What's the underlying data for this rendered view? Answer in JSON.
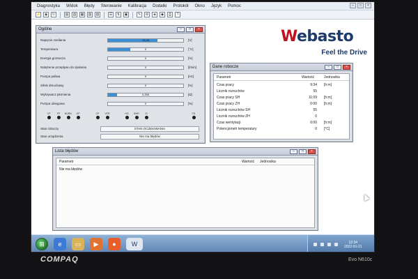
{
  "menubar": {
    "items": [
      "Diagnostyka",
      "Widok",
      "Błędy",
      "Sterowanie",
      "Kalibracja",
      "Dodatki",
      "Protokół",
      "Okno",
      "Język",
      "Pomoc"
    ]
  },
  "desktop": {
    "brand": {
      "prefix": "W",
      "rest": "ebasto",
      "slogan": "Feel the Drive"
    }
  },
  "ogolne": {
    "title": "Ogólne",
    "params": [
      {
        "label": "Napięcie zasilania",
        "value": "13,49",
        "unit": "[V]",
        "fill": 0.66
      },
      {
        "label": "Temperatura",
        "value": "0",
        "unit": "[°C]",
        "fill": 0.3
      },
      {
        "label": "Energia grzewcza",
        "value": "0",
        "unit": "[%]",
        "fill": 0
      },
      {
        "label": "Natężenie przepływu do spalania",
        "value": "0",
        "unit": "[l/min]",
        "fill": 0
      },
      {
        "label": "Pompa paliwa",
        "value": "0",
        "unit": "[Hz]",
        "fill": 0
      },
      {
        "label": "Silnik dmuchawy",
        "value": "0",
        "unit": "[%]",
        "fill": 0
      },
      {
        "label": "Wykrywacz płomienia",
        "value": "0,266",
        "unit": "[Ω]",
        "fill": 0.12
      },
      {
        "label": "Pompa obiegowa",
        "value": "0",
        "unit": "[%]",
        "fill": 0
      }
    ],
    "indicators": [
      {
        "label": "CP"
      },
      {
        "label": "FP"
      },
      {
        "label": "BURN"
      },
      {
        "label": "GP"
      },
      {
        "label": "CP"
      },
      {
        "label": "VFR"
      },
      {
        "label": "HG"
      },
      {
        "label": "BHR"
      },
      {
        "label": "SI"
      },
      {
        "label": "FD"
      }
    ],
    "status": [
      {
        "label": "Stan roboczy",
        "value": "STAN OCZEKIWANIA"
      },
      {
        "label": "Stan urządzenia",
        "value": "Nie ma błędów"
      }
    ]
  },
  "dane": {
    "title": "Dane robocze",
    "headers": {
      "param": "Parametr",
      "value": "Wartość",
      "unit": "Jednostka"
    },
    "rows": [
      {
        "param": "Czas pracy",
        "value": "9:34",
        "unit": "[h:m]"
      },
      {
        "param": "Licznik rozruchów",
        "value": "55",
        "unit": ""
      },
      {
        "param": "Czas pracy SH",
        "value": "11:09",
        "unit": "[h:m]"
      },
      {
        "param": "Czas pracy ZH",
        "value": "0:00",
        "unit": "[h:m]"
      },
      {
        "param": "Licznik rozruchów SH",
        "value": "55",
        "unit": ""
      },
      {
        "param": "Licznik rozruchów ZH",
        "value": "0",
        "unit": ""
      },
      {
        "param": "Czas wentylacji",
        "value": "0:00",
        "unit": "[h:m]"
      },
      {
        "param": "Potencjometr temperatury",
        "value": "0",
        "unit": "[°C]"
      }
    ]
  },
  "lista": {
    "title": "Lista błędów",
    "headers": {
      "param": "Parametr",
      "value": "Wartość",
      "unit": "Jednostka"
    },
    "rows": [
      {
        "param": "Nie ma błędów"
      }
    ]
  },
  "taskbar": {
    "clock_time": "12:34",
    "clock_date": "2022-01-21"
  },
  "hardware": {
    "brand": "COMPAQ",
    "model": "Evo N610c"
  }
}
